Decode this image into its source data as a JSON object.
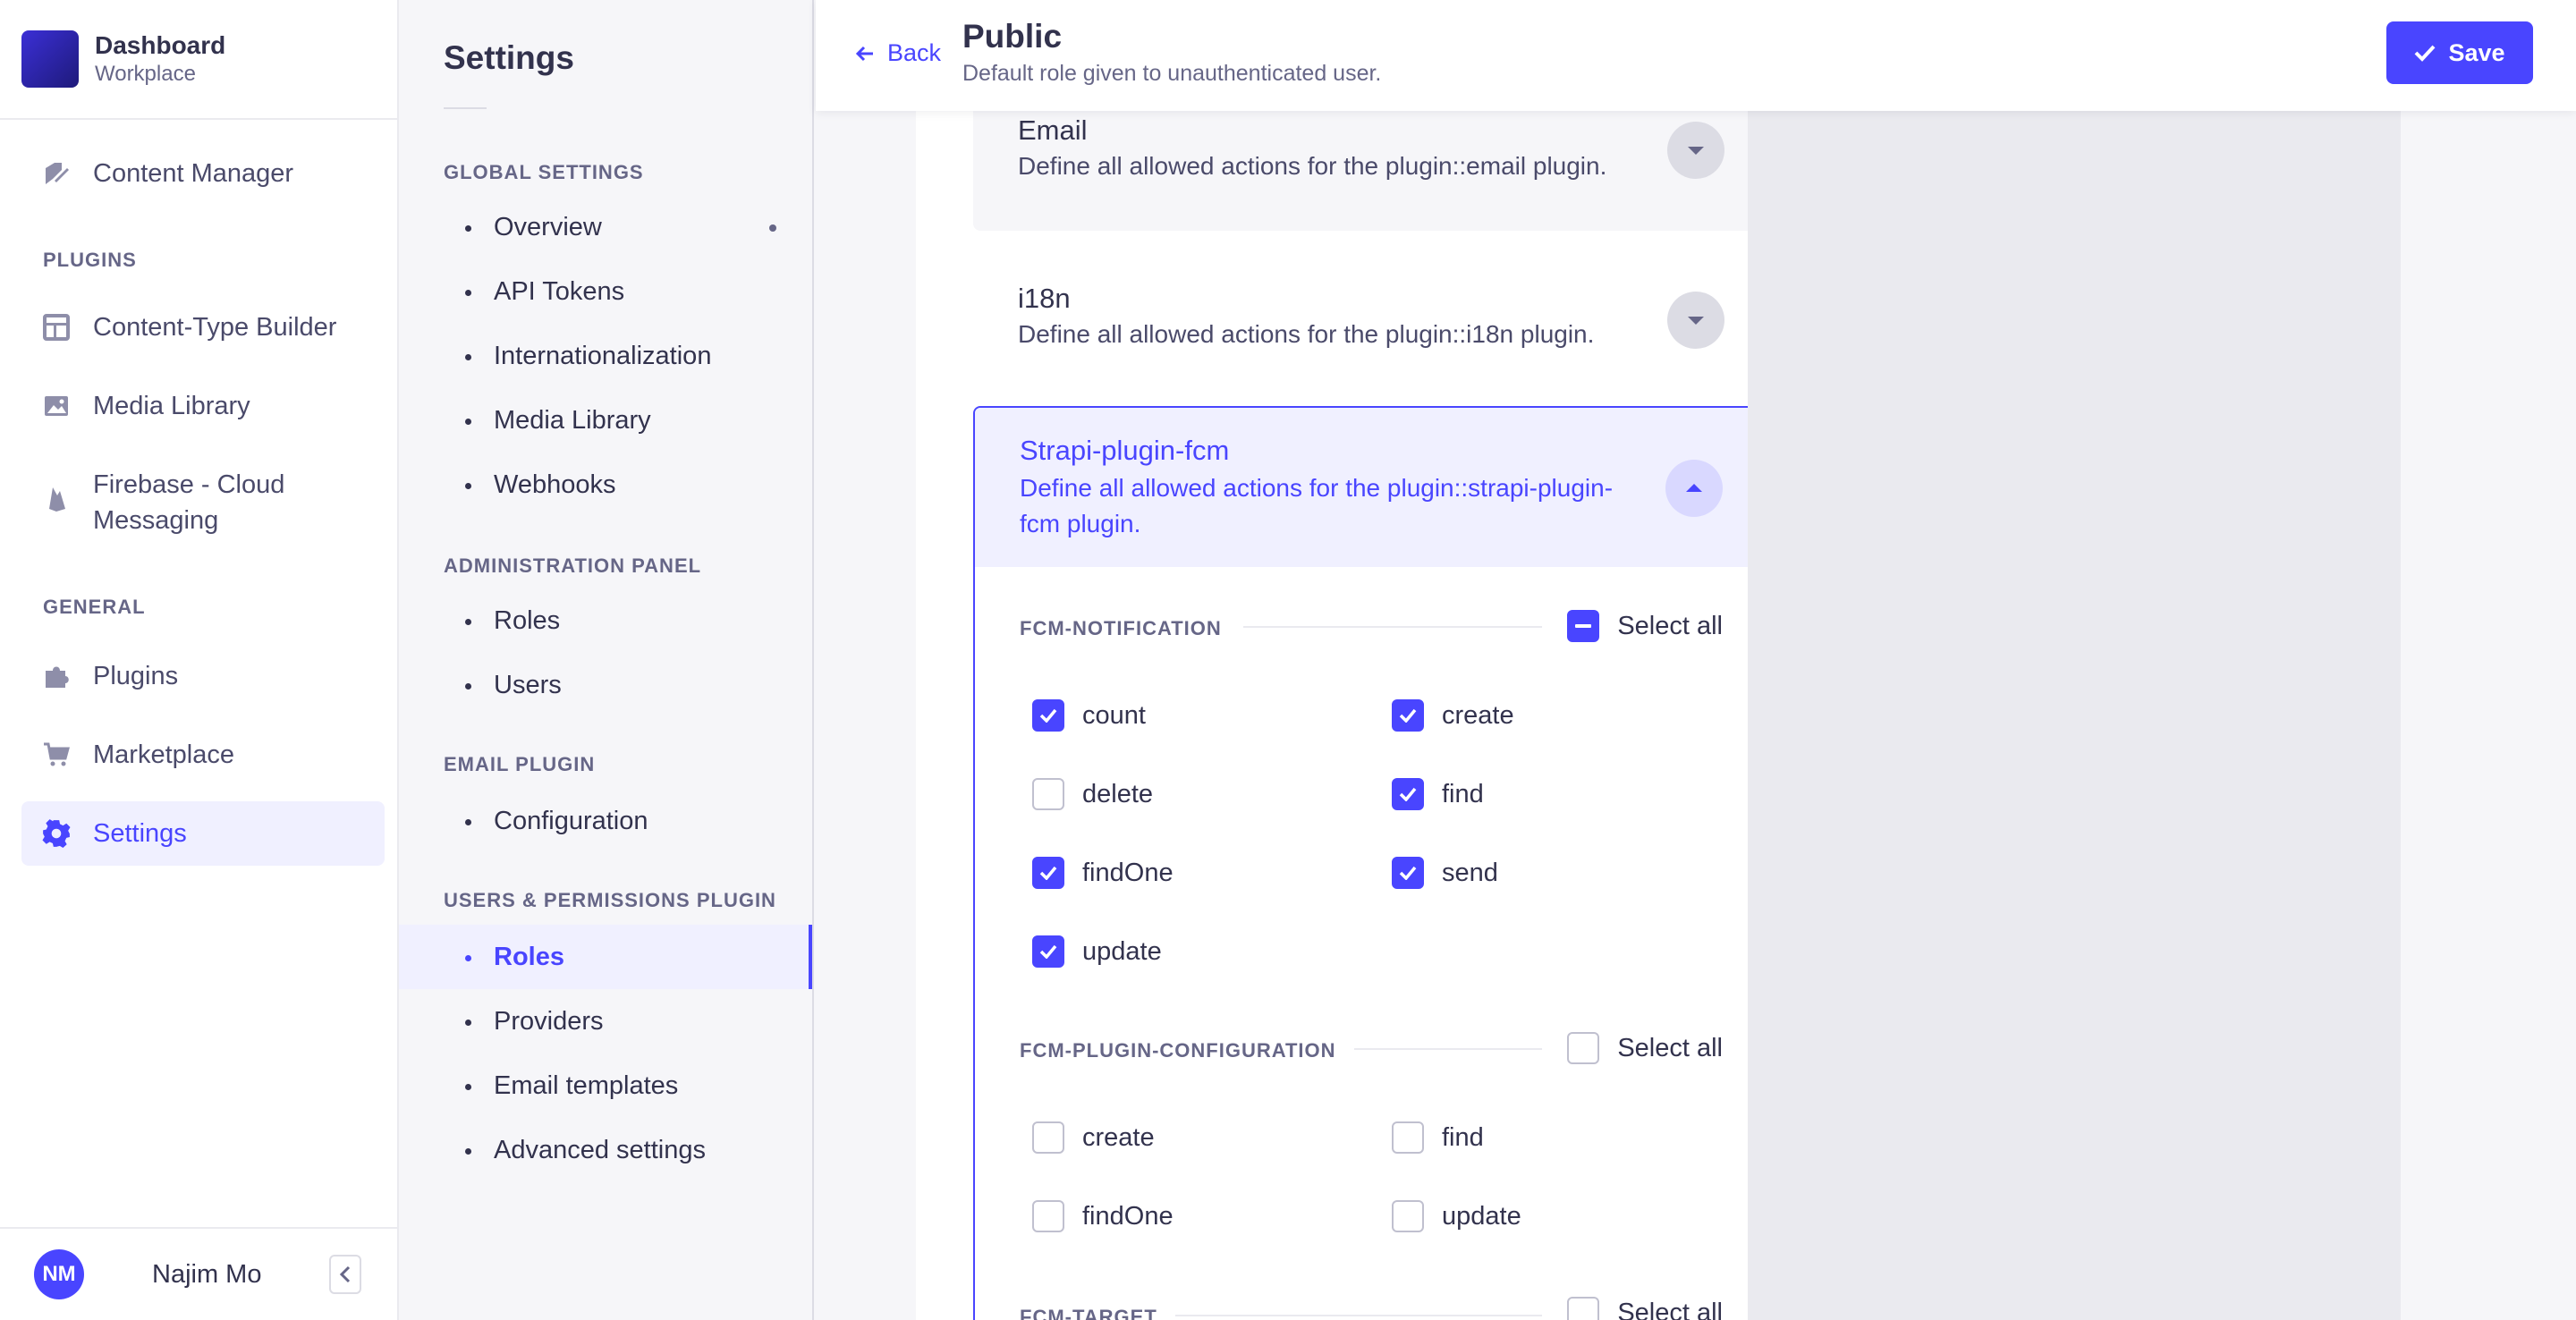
{
  "brand": {
    "title": "Dashboard",
    "subtitle": "Workplace"
  },
  "mainnav": {
    "content_manager": "Content Manager",
    "plugins_section": "PLUGINS",
    "ctb": "Content-Type Builder",
    "media": "Media Library",
    "firebase_line1": "Firebase - Cloud",
    "firebase_line2": "Messaging",
    "general_section": "GENERAL",
    "plugins": "Plugins",
    "marketplace": "Marketplace",
    "settings": "Settings"
  },
  "footer": {
    "initials": "NM",
    "name": "Najim Mo"
  },
  "subnav": {
    "title": "Settings",
    "global_section": "GLOBAL SETTINGS",
    "overview": "Overview",
    "api_tokens": "API Tokens",
    "i18n": "Internationalization",
    "media": "Media Library",
    "webhooks": "Webhooks",
    "admin_section": "ADMINISTRATION PANEL",
    "roles": "Roles",
    "users": "Users",
    "email_section": "EMAIL PLUGIN",
    "configuration": "Configuration",
    "up_section": "USERS & PERMISSIONS PLUGIN",
    "up_roles": "Roles",
    "providers": "Providers",
    "email_templates": "Email templates",
    "advanced": "Advanced settings"
  },
  "header": {
    "back": "Back",
    "title": "Public",
    "subtitle": "Default role given to unauthenticated user.",
    "save": "Save"
  },
  "accordions": {
    "email": {
      "title": "Email",
      "desc": "Define all allowed actions for the plugin::email plugin."
    },
    "i18n": {
      "title": "i18n",
      "desc": "Define all allowed actions for the plugin::i18n plugin."
    },
    "fcm": {
      "title": "Strapi-plugin-fcm",
      "desc_line1": "Define all allowed actions for the plugin::strapi-plugin-",
      "desc_line2": "fcm plugin."
    }
  },
  "groups": {
    "select_all": "Select all",
    "notification": {
      "title": "FCM-NOTIFICATION",
      "perms": [
        {
          "label": "count",
          "checked": true
        },
        {
          "label": "create",
          "checked": true
        },
        {
          "label": "delete",
          "checked": false
        },
        {
          "label": "find",
          "checked": true
        },
        {
          "label": "findOne",
          "checked": true
        },
        {
          "label": "send",
          "checked": true
        },
        {
          "label": "update",
          "checked": true
        }
      ]
    },
    "config": {
      "title": "FCM-PLUGIN-CONFIGURATION",
      "perms": [
        {
          "label": "create",
          "checked": false
        },
        {
          "label": "find",
          "checked": false
        },
        {
          "label": "findOne",
          "checked": false
        },
        {
          "label": "update",
          "checked": false
        }
      ]
    },
    "target": {
      "title": "FCM-TARGET"
    }
  },
  "colors": {
    "primary": "#4945ff",
    "primary_light": "#f0f0ff",
    "text": "#32324d",
    "muted": "#666687"
  }
}
